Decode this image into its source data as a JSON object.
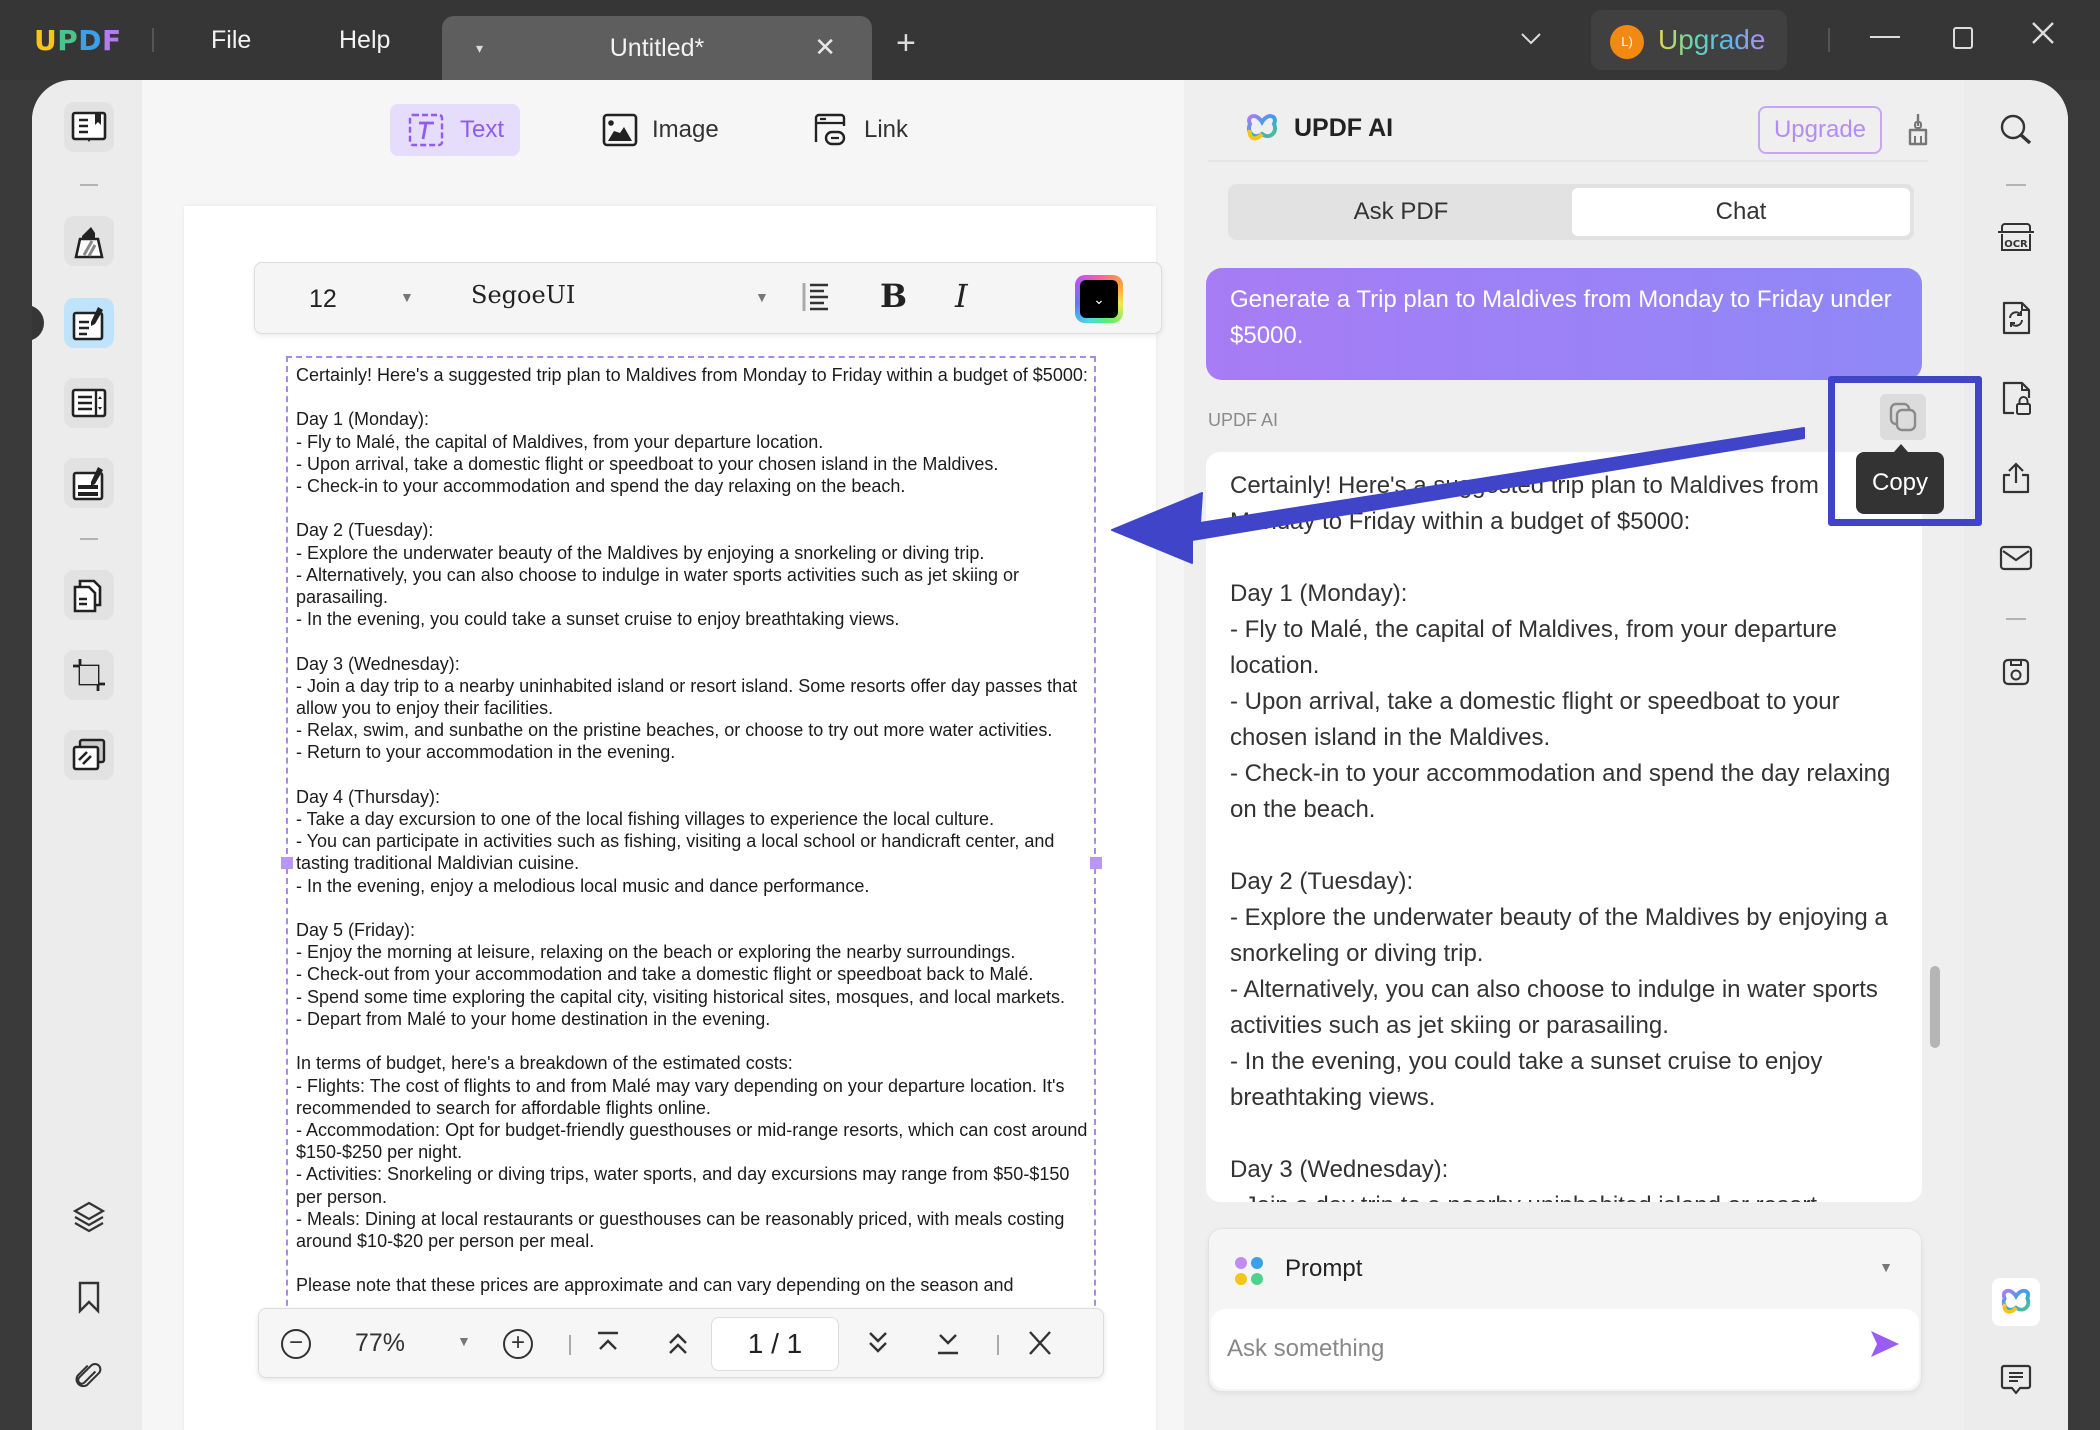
{
  "titlebar": {
    "logo": {
      "u": "U",
      "p": "P",
      "d": "D",
      "f": "F"
    },
    "menu": [
      "File",
      "Help"
    ],
    "tab": {
      "name": "Untitled*",
      "caret": "▾",
      "close": "✕"
    },
    "new_tab": "+",
    "dropdown": "⌵",
    "avatar_initials": "L)",
    "upgrade_label": "Upgrade"
  },
  "edit_modes": [
    {
      "label": "Text",
      "icon": "text-box-icon",
      "active": true
    },
    {
      "label": "Image",
      "icon": "image-icon",
      "active": false
    },
    {
      "label": "Link",
      "icon": "link-icon",
      "active": false
    }
  ],
  "format_bar": {
    "font_size": "12",
    "font_family": "SegoeUI",
    "bold_label": "B",
    "italic_label": "I",
    "text_color": "#000000"
  },
  "document": {
    "text": "Certainly! Here's a suggested trip plan to Maldives from Monday to Friday within a budget of $5000:\n\nDay 1 (Monday):\n- Fly to Malé, the capital of Maldives, from your departure location.\n- Upon arrival, take a domestic flight or speedboat to your chosen island in the Maldives.\n- Check-in to your accommodation and spend the day relaxing on the beach.\n\nDay 2 (Tuesday):\n- Explore the underwater beauty of the Maldives by enjoying a snorkeling or diving trip.\n- Alternatively, you can also choose to indulge in water sports activities such as jet skiing or parasailing.\n- In the evening, you could take a sunset cruise to enjoy breathtaking views.\n\nDay 3 (Wednesday):\n- Join a day trip to a nearby uninhabited island or resort island. Some resorts offer day passes that allow you to enjoy their facilities.\n- Relax, swim, and sunbathe on the pristine beaches, or choose to try out more water activities.\n- Return to your accommodation in the evening.\n\nDay 4 (Thursday):\n- Take a day excursion to one of the local fishing villages to experience the local culture.\n- You can participate in activities such as fishing, visiting a local school or handicraft center, and tasting traditional Maldivian cuisine.\n- In the evening, enjoy a melodious local music and dance performance.\n\nDay 5 (Friday):\n- Enjoy the morning at leisure, relaxing on the beach or exploring the nearby surroundings.\n- Check-out from your accommodation and take a domestic flight or speedboat back to Malé.\n- Spend some time exploring the capital city, visiting historical sites, mosques, and local markets.\n- Depart from Malé to your home destination in the evening.\n\nIn terms of budget, here's a breakdown of the estimated costs:\n- Flights: The cost of flights to and from Malé may vary depending on your departure location. It's recommended to search for affordable flights online.\n- Accommodation: Opt for budget-friendly guesthouses or mid-range resorts, which can cost around $150-$250 per night.\n- Activities: Snorkeling or diving trips, water sports, and day excursions may range from $50-$150 per person.\n- Meals: Dining at local restaurants or guesthouses can be reasonably priced, with meals costing around $10-$20 per person per meal.\n\nPlease note that these prices are approximate and can vary depending on the season and"
  },
  "zoom_bar": {
    "zoom_out": "−",
    "zoom_level": "77%",
    "zoom_in": "+",
    "page_indicator": "1 / 1",
    "close": "✕"
  },
  "ai_panel": {
    "title": "UPDF AI",
    "upgrade_label": "Upgrade",
    "tabs": [
      {
        "label": "Ask PDF",
        "active": false
      },
      {
        "label": "Chat",
        "active": true
      }
    ],
    "user_message": "Generate a Trip plan to Maldives from Monday to Friday under $5000.",
    "responder_label": "UPDF AI",
    "copy_tooltip": "Copy",
    "response_text": "Certainly! Here's a suggested trip plan to Maldives from Monday to Friday within a budget of $5000:\n\nDay 1 (Monday):\n- Fly to Malé, the capital of Maldives, from your departure location.\n- Upon arrival, take a domestic flight or speedboat to your chosen island in the Maldives.\n- Check-in to your accommodation and spend the day relaxing on the beach.\n\nDay 2 (Tuesday):\n- Explore the underwater beauty of the Maldives by enjoying a snorkeling or diving trip.\n- Alternatively, you can also choose to indulge in water sports activities such as jet skiing or parasailing.\n- In the evening, you could take a sunset cruise to enjoy breathtaking views.\n\nDay 3 (Wednesday):\n- Join a day trip to a nearby uninhabited island or resort",
    "prompt_label": "Prompt",
    "input_placeholder": "Ask something"
  },
  "colors": {
    "accent_purple": "#8f5cf0",
    "annotation_blue": "#3f44c8",
    "titlebar_bg": "#363636"
  }
}
